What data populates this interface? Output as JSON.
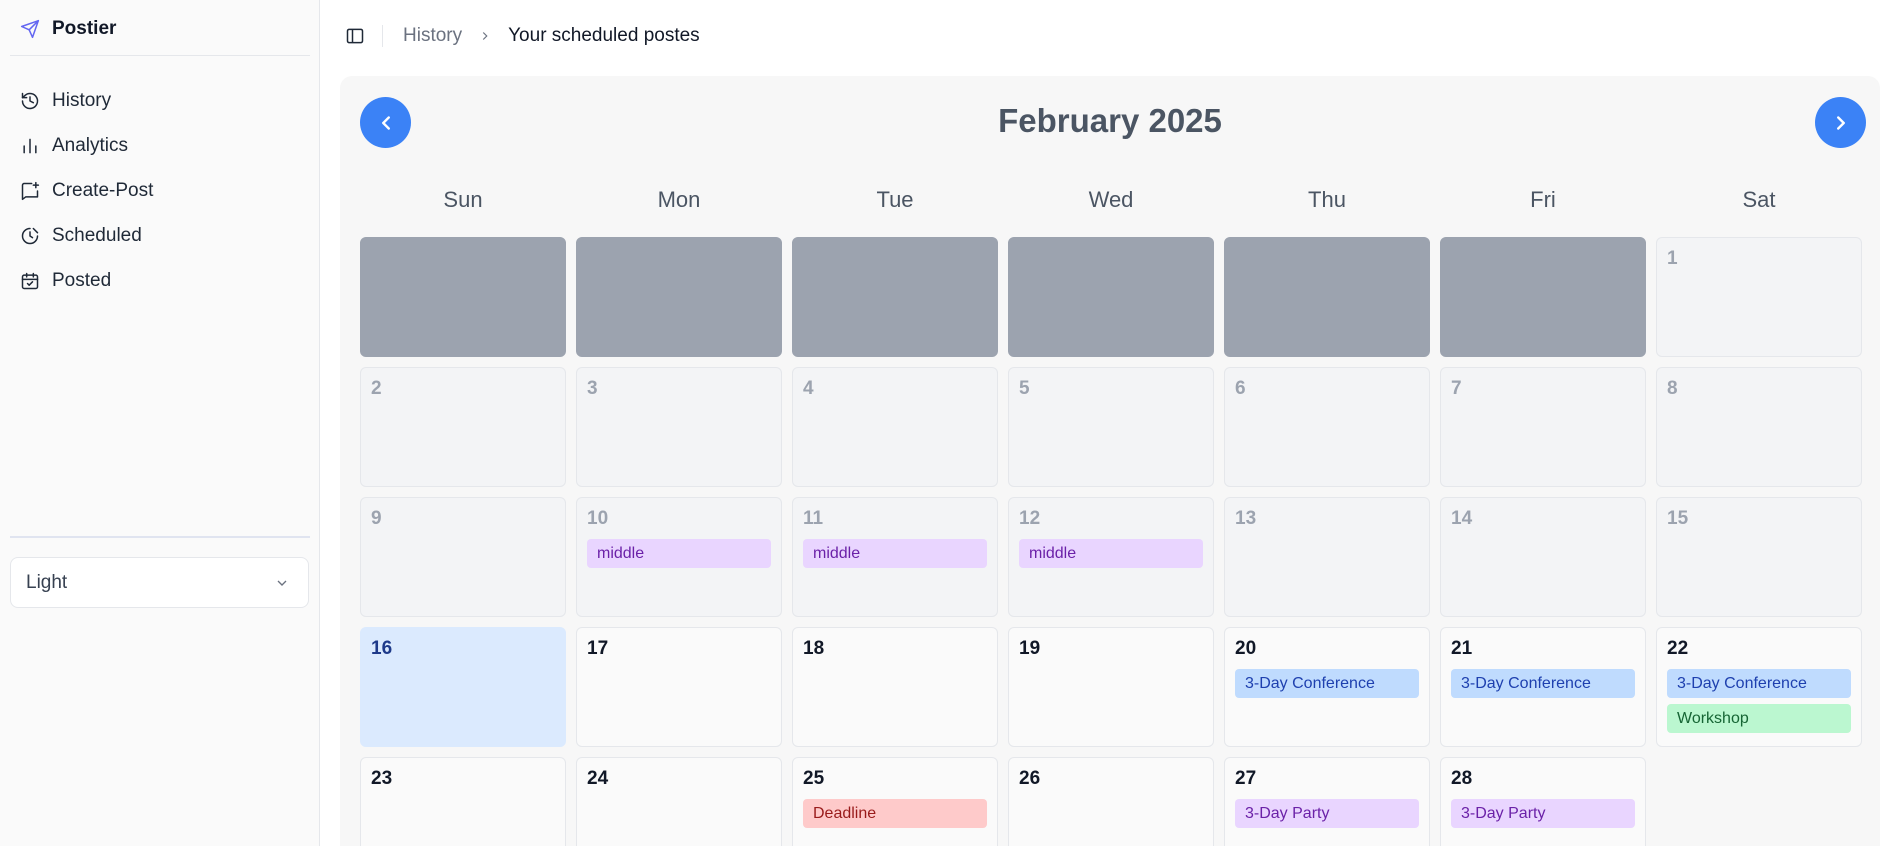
{
  "app": {
    "name": "Postier"
  },
  "sidebar": {
    "items": [
      {
        "label": "History",
        "icon": "history-icon"
      },
      {
        "label": "Analytics",
        "icon": "bar-chart-icon"
      },
      {
        "label": "Create-Post",
        "icon": "message-plus-icon"
      },
      {
        "label": "Scheduled",
        "icon": "clock-icon"
      },
      {
        "label": "Posted",
        "icon": "calendar-check-icon"
      }
    ],
    "theme": {
      "value": "Light"
    }
  },
  "breadcrumb": {
    "parent": "History",
    "current": "Your scheduled postes"
  },
  "calendar": {
    "title": "February 2025",
    "weekdays": [
      "Sun",
      "Mon",
      "Tue",
      "Wed",
      "Thu",
      "Fri",
      "Sat"
    ],
    "cells": [
      {
        "type": "filler"
      },
      {
        "type": "filler"
      },
      {
        "type": "filler"
      },
      {
        "type": "filler"
      },
      {
        "type": "filler"
      },
      {
        "type": "filler"
      },
      {
        "type": "past",
        "day": "1",
        "events": []
      },
      {
        "type": "past",
        "day": "2",
        "events": []
      },
      {
        "type": "past",
        "day": "3",
        "events": []
      },
      {
        "type": "past",
        "day": "4",
        "events": []
      },
      {
        "type": "past",
        "day": "5",
        "events": []
      },
      {
        "type": "past",
        "day": "6",
        "events": []
      },
      {
        "type": "past",
        "day": "7",
        "events": []
      },
      {
        "type": "past",
        "day": "8",
        "events": []
      },
      {
        "type": "past",
        "day": "9",
        "events": []
      },
      {
        "type": "past",
        "day": "10",
        "events": [
          {
            "title": "middle",
            "color": "purple"
          }
        ]
      },
      {
        "type": "past",
        "day": "11",
        "events": [
          {
            "title": "middle",
            "color": "purple"
          }
        ]
      },
      {
        "type": "past",
        "day": "12",
        "events": [
          {
            "title": "middle",
            "color": "purple"
          }
        ]
      },
      {
        "type": "past",
        "day": "13",
        "events": []
      },
      {
        "type": "past",
        "day": "14",
        "events": []
      },
      {
        "type": "past",
        "day": "15",
        "events": []
      },
      {
        "type": "today",
        "day": "16",
        "events": []
      },
      {
        "type": "future",
        "day": "17",
        "events": []
      },
      {
        "type": "future",
        "day": "18",
        "events": []
      },
      {
        "type": "future",
        "day": "19",
        "events": []
      },
      {
        "type": "future",
        "day": "20",
        "events": [
          {
            "title": "3-Day Conference",
            "color": "blue"
          }
        ]
      },
      {
        "type": "future",
        "day": "21",
        "events": [
          {
            "title": "3-Day Conference",
            "color": "blue"
          }
        ]
      },
      {
        "type": "future",
        "day": "22",
        "events": [
          {
            "title": "3-Day Conference",
            "color": "blue"
          },
          {
            "title": "Workshop",
            "color": "green"
          }
        ]
      },
      {
        "type": "future",
        "day": "23",
        "events": []
      },
      {
        "type": "future",
        "day": "24",
        "events": []
      },
      {
        "type": "future",
        "day": "25",
        "events": [
          {
            "title": "Deadline",
            "color": "red"
          }
        ]
      },
      {
        "type": "future",
        "day": "26",
        "events": []
      },
      {
        "type": "future",
        "day": "27",
        "events": [
          {
            "title": "3-Day Party",
            "color": "purple"
          }
        ]
      },
      {
        "type": "future",
        "day": "28",
        "events": [
          {
            "title": "3-Day Party",
            "color": "purple"
          }
        ]
      },
      {
        "type": "empty"
      }
    ]
  },
  "colors": {
    "accent": "#3b82f6",
    "today": "#dbeafe",
    "filler": "#9ca3af",
    "event_purple": "#e9d5ff",
    "event_blue": "#bfdbfe",
    "event_green": "#bbf7d0",
    "event_red": "#fecaca"
  }
}
